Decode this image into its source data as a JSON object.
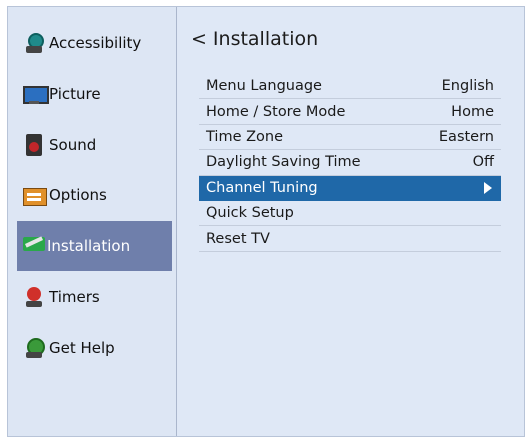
{
  "sidebar": {
    "items": [
      {
        "label": "Accessibility",
        "icon": "accessibility-icon"
      },
      {
        "label": "Picture",
        "icon": "picture-icon"
      },
      {
        "label": "Sound",
        "icon": "sound-icon"
      },
      {
        "label": "Options",
        "icon": "options-icon"
      },
      {
        "label": "Installation",
        "icon": "installation-icon",
        "selected": true
      },
      {
        "label": "Timers",
        "icon": "timers-icon"
      },
      {
        "label": "Get Help",
        "icon": "get-help-icon"
      }
    ]
  },
  "main": {
    "chevron": "<",
    "title": "Installation",
    "rows": [
      {
        "label": "Menu Language",
        "value": "English"
      },
      {
        "label": "Home / Store Mode",
        "value": "Home"
      },
      {
        "label": "Time Zone",
        "value": "Eastern"
      },
      {
        "label": "Daylight Saving Time",
        "value": "Off"
      },
      {
        "label": "Channel Tuning",
        "value": "",
        "selected": true
      },
      {
        "label": "Quick Setup",
        "value": ""
      },
      {
        "label": "Reset TV",
        "value": ""
      }
    ]
  },
  "colors": {
    "selected_row": "#1f68a8",
    "selected_sidebar": "#6f7fab",
    "panel_bg": "#dfe8f6"
  }
}
